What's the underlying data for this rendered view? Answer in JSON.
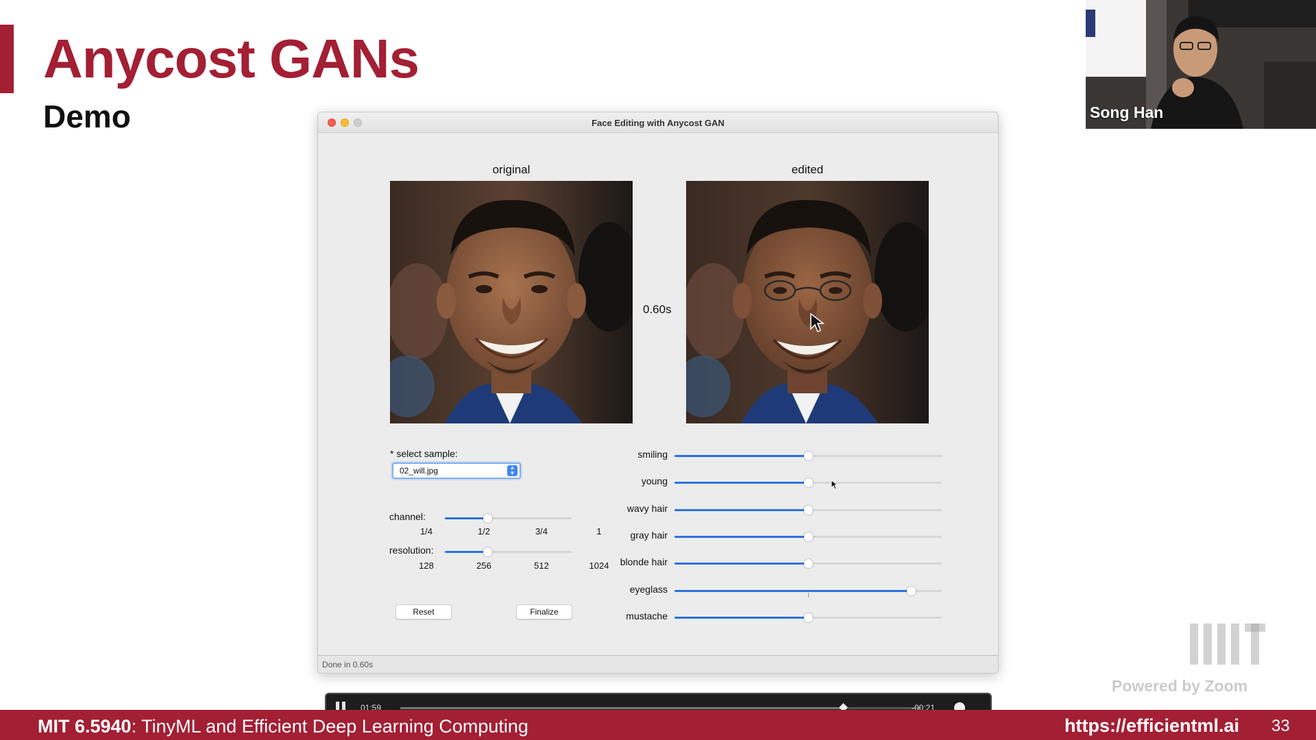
{
  "slide": {
    "title": "Anycost GANs",
    "subtitle": "Demo",
    "page_number": "33"
  },
  "footer": {
    "course_code": "MIT 6.5940",
    "course_title": ": TinyML and Efficient Deep Learning Computing",
    "url": "https://efficientml.ai"
  },
  "speaker": {
    "name": "Song Han"
  },
  "watermark": {
    "text": "Powered by Zoom"
  },
  "app": {
    "window_title": "Face Editing with Anycost GAN",
    "original_label": "original",
    "edited_label": "edited",
    "timing": "0.60s",
    "select_label": "* select sample:",
    "select_value": "02_will.jpg",
    "channel": {
      "label": "channel:",
      "ticks": [
        "1/4",
        "1/2",
        "3/4",
        "1"
      ],
      "value_fraction": 0.333
    },
    "resolution": {
      "label": "resolution:",
      "ticks": [
        "128",
        "256",
        "512",
        "1024"
      ],
      "value_fraction": 0.333
    },
    "reset_label": "Reset",
    "finalize_label": "Finalize",
    "attributes": [
      {
        "label": "smiling",
        "value": 0.5
      },
      {
        "label": "young",
        "value": 0.5
      },
      {
        "label": "wavy hair",
        "value": 0.5
      },
      {
        "label": "gray hair",
        "value": 0.5
      },
      {
        "label": "blonde hair",
        "value": 0.5
      },
      {
        "label": "eyeglass",
        "value": 0.885
      },
      {
        "label": "mustache",
        "value": 0.5
      }
    ],
    "status": "Done in 0.60s"
  },
  "player": {
    "elapsed": "01:59",
    "remaining": "-00:21",
    "progress": 0.85
  },
  "colors": {
    "accent": "#a31f34",
    "slider_blue": "#2b72e0"
  }
}
